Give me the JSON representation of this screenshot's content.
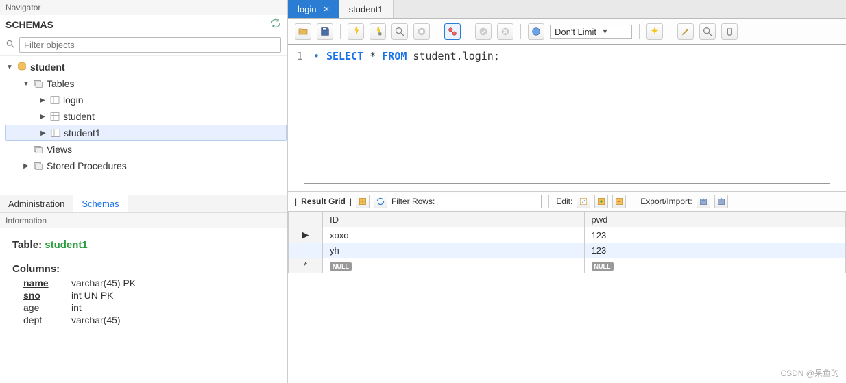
{
  "navigator": {
    "title": "Navigator"
  },
  "schemas_header": "SCHEMAS",
  "filter": {
    "placeholder": "Filter objects"
  },
  "tree": {
    "db": "student",
    "tables_label": "Tables",
    "tables": [
      "login",
      "student",
      "student1"
    ],
    "selected_table": "student1",
    "views_label": "Views",
    "sp_label": "Stored Procedures"
  },
  "bottom_tabs": {
    "admin": "Administration",
    "schemas": "Schemas"
  },
  "information": {
    "title": "Information",
    "table_label": "Table:",
    "table_name": "student1",
    "columns_label": "Columns:",
    "columns": [
      {
        "name": "name",
        "type": "varchar(45) PK",
        "pk": true
      },
      {
        "name": "sno",
        "type": "int UN PK",
        "pk": true
      },
      {
        "name": "age",
        "type": "int",
        "pk": false
      },
      {
        "name": "dept",
        "type": "varchar(45)",
        "pk": false
      }
    ]
  },
  "editor_tabs": [
    {
      "label": "login",
      "active": true
    },
    {
      "label": "student1",
      "active": false
    }
  ],
  "limit_label": "Don't Limit",
  "sql": {
    "line_no": "1",
    "kw1": "SELECT",
    "star": " * ",
    "kw2": "FROM",
    "rest": " student.login;"
  },
  "result_bar": {
    "grid_label": "Result Grid",
    "filter_label": "Filter Rows:",
    "edit_label": "Edit:",
    "export_label": "Export/Import:"
  },
  "result_grid": {
    "columns": [
      "ID",
      "pwd"
    ],
    "rows": [
      {
        "ID": "xoxo",
        "pwd": "123"
      },
      {
        "ID": "yh",
        "pwd": "123"
      }
    ],
    "null_label": "NULL"
  },
  "watermark": "CSDN @呆鱼的"
}
